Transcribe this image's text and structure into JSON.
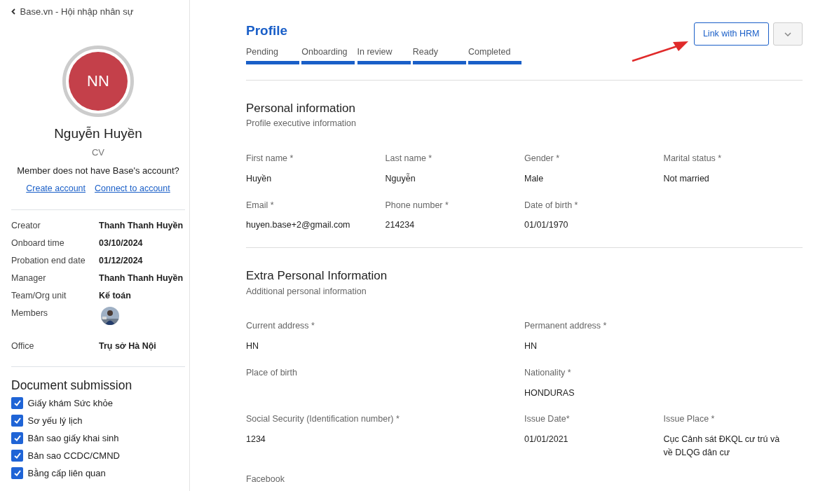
{
  "back_link": {
    "label": "Base.vn - Hội nhập nhân sự"
  },
  "profile": {
    "initials": "NN",
    "name": "Nguyễn Huyền",
    "position": "CV",
    "account_prompt": "Member does not have Base's account?",
    "links": [
      "Create account",
      "Connect to account"
    ]
  },
  "details": [
    {
      "label": "Creator",
      "value": "Thanh Thanh Huyền"
    },
    {
      "label": "Onboard time",
      "value": "03/10/2024"
    },
    {
      "label": "Probation end date",
      "value": "01/12/2024"
    },
    {
      "label": "Manager",
      "value": "Thanh Thanh Huyền"
    },
    {
      "label": "Team/Org unit",
      "value": "Kế toán"
    },
    {
      "label": "Members",
      "kind": "avatars"
    },
    {
      "label": "Office",
      "value": "Trụ sở Hà Nội"
    }
  ],
  "documents": {
    "title": "Document submission",
    "items": [
      {
        "label": "Giấy khám Sức khỏe",
        "checked": true
      },
      {
        "label": "Sơ yếu lý lịch",
        "checked": true
      },
      {
        "label": "Bản sao giấy khai sinh",
        "checked": true
      },
      {
        "label": "Bản sao CCDC/CMND",
        "checked": true
      },
      {
        "label": "Bằng cấp liên quan",
        "checked": true
      }
    ]
  },
  "main": {
    "title": "Profile",
    "buttons": [
      "Link with HRM"
    ],
    "stages": [
      {
        "label": "Pending",
        "done": true
      },
      {
        "label": "Onboarding",
        "done": true
      },
      {
        "label": "In review",
        "done": true
      },
      {
        "label": "Ready",
        "done": true
      },
      {
        "label": "Completed",
        "done": true
      }
    ],
    "sections": [
      {
        "title": "Personal information",
        "subtitle": "Profile executive information",
        "fields": [
          {
            "label": "First name *",
            "value": "Huyền",
            "kind": "normal"
          },
          {
            "label": "Last name *",
            "value": "Nguyễn",
            "kind": "normal"
          },
          {
            "label": "Gender *",
            "value": "Male",
            "kind": "normal"
          },
          {
            "label": "Marital status *",
            "value": "Not married",
            "kind": "normal"
          },
          {
            "label": "Email *",
            "value": "huyen.base+2@gmail.com",
            "kind": "normal"
          },
          {
            "label": "Phone number *",
            "value": "214234",
            "kind": "normal"
          },
          {
            "label": "Date of birth *",
            "value": "01/01/1970",
            "kind": "normal"
          }
        ]
      },
      {
        "title": "Extra Personal Information",
        "subtitle": "Additional personal information",
        "fields": [
          {
            "label": "Current address *",
            "value": "HN",
            "kind": "wide"
          },
          {
            "label": "Permanent address *",
            "value": "HN",
            "kind": "wide"
          },
          {
            "label": "Place of birth",
            "kind": "wide"
          },
          {
            "label": "Nationality *",
            "value": "HONDURAS",
            "kind": "wide"
          },
          {
            "label": "Social Security (Identification number) *",
            "value": "1234",
            "kind": "wide"
          },
          {
            "label": "Issue Date*",
            "value": "01/01/2021",
            "kind": "normal"
          },
          {
            "label": "Issue Place *",
            "value": "Cục Cảnh sát ĐKQL cư trú và về DLQG dân cư",
            "kind": "normal"
          },
          {
            "label": "Facebook",
            "kind": "normal"
          }
        ]
      }
    ]
  }
}
